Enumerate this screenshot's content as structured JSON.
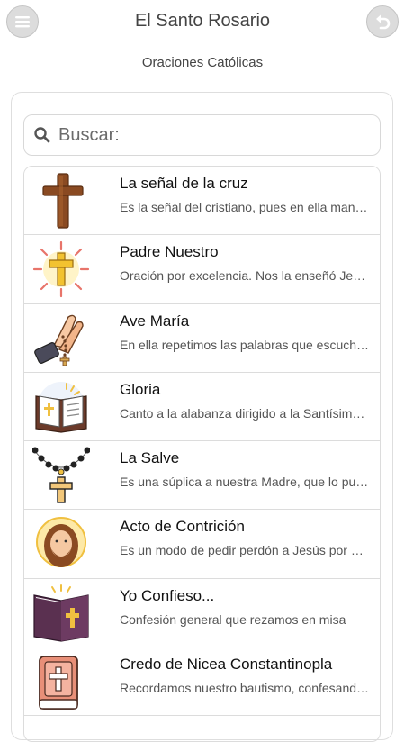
{
  "header": {
    "title": "El Santo Rosario",
    "subtitle": "Oraciones Católicas",
    "menu_icon": "hamburger-menu-icon",
    "back_icon": "undo-arrow-icon"
  },
  "search": {
    "placeholder": "Buscar:"
  },
  "prayers": [
    {
      "title": "La señal de la cruz",
      "desc": "Es la señal del cristiano, pues en ella manifestamos nuestra fe",
      "icon": "wooden-cross-icon"
    },
    {
      "title": "Padre Nuestro",
      "desc": "Oración por excelencia. Nos la enseñó Jesús",
      "icon": "radiant-cross-icon"
    },
    {
      "title": "Ave María",
      "desc": "En ella repetimos las palabras que escuchó María",
      "icon": "praying-hands-rosary-icon"
    },
    {
      "title": "Gloria",
      "desc": "Canto a la alabanza dirigido a la Santísima Trinidad",
      "icon": "open-bible-icon"
    },
    {
      "title": "La Salve",
      "desc": "Es una súplica a nuestra Madre, que lo puede todo",
      "icon": "rosary-beads-icon"
    },
    {
      "title": "Acto de Contrición",
      "desc": "Es un modo de pedir perdón a Jesús por nuestros pecados",
      "icon": "jesus-face-icon"
    },
    {
      "title": "Yo Confieso...",
      "desc": "Confesión general que rezamos en misa",
      "icon": "holy-bible-book-icon"
    },
    {
      "title": "Credo de Nicea Constantinopla",
      "desc": "Recordamos nuestro bautismo, confesando la fe",
      "icon": "closed-bible-icon"
    }
  ]
}
